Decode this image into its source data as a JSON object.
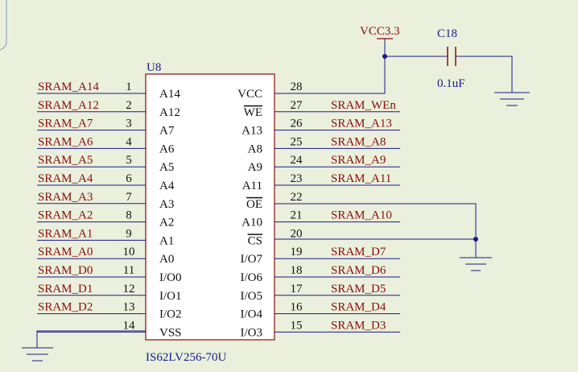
{
  "colors": {
    "background": "#eaf0dc",
    "wire": "#1a1a8c",
    "net_label": "#8b0b0b",
    "component_outline": "#8b0b0b",
    "component_fill": "#ffffff",
    "pin_text": "#111111",
    "junction": "#1a1a8c"
  },
  "chip": {
    "designator": "U8",
    "part": "IS62LV256-70U"
  },
  "left_pins": [
    {
      "num": "1",
      "name": "A14",
      "net": "SRAM_A14"
    },
    {
      "num": "2",
      "name": "A12",
      "net": "SRAM_A12"
    },
    {
      "num": "3",
      "name": "A7",
      "net": "SRAM_A7"
    },
    {
      "num": "4",
      "name": "A6",
      "net": "SRAM_A6"
    },
    {
      "num": "5",
      "name": "A5",
      "net": "SRAM_A5"
    },
    {
      "num": "6",
      "name": "A4",
      "net": "SRAM_A4"
    },
    {
      "num": "7",
      "name": "A3",
      "net": "SRAM_A3"
    },
    {
      "num": "8",
      "name": "A2",
      "net": "SRAM_A2"
    },
    {
      "num": "9",
      "name": "A1",
      "net": "SRAM_A1"
    },
    {
      "num": "10",
      "name": "A0",
      "net": "SRAM_A0"
    },
    {
      "num": "11",
      "name": "I/O0",
      "net": "SRAM_D0"
    },
    {
      "num": "12",
      "name": "I/O1",
      "net": "SRAM_D1"
    },
    {
      "num": "13",
      "name": "I/O2",
      "net": "SRAM_D2"
    },
    {
      "num": "14",
      "name": "VSS",
      "net": ""
    }
  ],
  "right_pins": [
    {
      "num": "28",
      "name": "VCC",
      "net": ""
    },
    {
      "num": "27",
      "name": "WE",
      "net": "SRAM_WEn",
      "overbar": true
    },
    {
      "num": "26",
      "name": "A13",
      "net": "SRAM_A13"
    },
    {
      "num": "25",
      "name": "A8",
      "net": "SRAM_A8"
    },
    {
      "num": "24",
      "name": "A9",
      "net": "SRAM_A9"
    },
    {
      "num": "23",
      "name": "A11",
      "net": "SRAM_A11"
    },
    {
      "num": "22",
      "name": "OE",
      "net": "",
      "overbar": true
    },
    {
      "num": "21",
      "name": "A10",
      "net": "SRAM_A10"
    },
    {
      "num": "20",
      "name": "CS",
      "net": "",
      "overbar": true
    },
    {
      "num": "19",
      "name": "I/O7",
      "net": "SRAM_D7"
    },
    {
      "num": "18",
      "name": "I/O6",
      "net": "SRAM_D6"
    },
    {
      "num": "17",
      "name": "I/O5",
      "net": "SRAM_D5"
    },
    {
      "num": "16",
      "name": "I/O4",
      "net": "SRAM_D4"
    },
    {
      "num": "15",
      "name": "I/O3",
      "net": "SRAM_D3"
    }
  ],
  "power": {
    "label": "VCC3.3"
  },
  "capacitor": {
    "designator": "C18",
    "value": "0.1uF"
  }
}
